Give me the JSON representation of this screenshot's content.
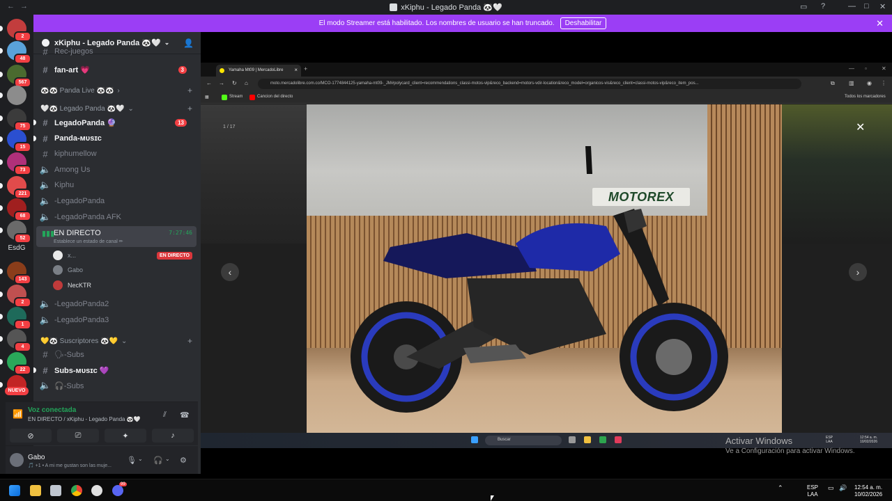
{
  "window": {
    "title": "xKiphu - Legado Panda 🐼🤍"
  },
  "streamer_banner": {
    "text": "El modo Streamer está habilitado. Los nombres de usuario se han truncado.",
    "button": "Deshabilitar"
  },
  "guilds": [
    {
      "badge": "2",
      "color": "#c23d3d"
    },
    {
      "badge": "48",
      "color": "#5aa2d9"
    },
    {
      "badge": "567",
      "color": "#4a6a2f"
    },
    {
      "badge": "",
      "color": "#8c8c8c"
    },
    {
      "badge": "75",
      "color": "#3b3b3b"
    },
    {
      "badge": "15",
      "color": "#2b4fd0"
    },
    {
      "badge": "73",
      "color": "#b0307a"
    },
    {
      "badge": "221",
      "color": "#e14b4b"
    },
    {
      "badge": "68",
      "color": "#a01f1f"
    },
    {
      "badge": "52",
      "color": "#6a6a6a"
    },
    {
      "badge": "143",
      "color": "#8a3d1a"
    },
    {
      "badge": "2",
      "color": "#c05050"
    },
    {
      "badge": "1",
      "color": "#1e6a5a"
    },
    {
      "badge": "4",
      "color": "#555555"
    },
    {
      "badge": "22",
      "color": "#2aa85a"
    },
    {
      "badge": "",
      "color": "#c22424"
    }
  ],
  "guild_text": {
    "esdg": "EsdG",
    "nuevo": "NUEVO"
  },
  "server": {
    "name": "xKiphu - Legado Panda 🐼🤍",
    "channels": {
      "top_cut": "Rec-juegos",
      "fanart": "fan-art 💗",
      "fanart_badge": "3",
      "cat_panda_live": "🐼🐼 Panda Live 🐼🐼",
      "cat_legado": "🤍🐼 Legado Panda 🐼🤍",
      "legado_panda": "LegadoPanda 🔮",
      "legado_panda_badge": "13",
      "panda_music": "Panda-ᴍᴜsɪᴄ",
      "kiphumellow": "kiphumellow",
      "among_us": "Among Us",
      "kiphu": "Kiphu",
      "legadopanda_v": "-LegadoPanda",
      "legadopanda_afk": "-LegadoPanda AFK",
      "live_name": "EN DIRECTO",
      "live_time": "7:27:46",
      "live_sub": "Establece un estado de canal ✏",
      "legadopanda2": "-LegadoPanda2",
      "legadopanda3": "-LegadoPanda3",
      "cat_subs": "💛🐼 Suscriptores 🐼💛",
      "subs_text": "🗣-Subs",
      "subs_music": "Subs-ᴍᴜsɪᴄ 💜",
      "subs_voice": "🎧-Subs"
    },
    "voice_users": [
      {
        "name": "x...",
        "live": "EN DIRECTO",
        "color": "#e9e9e9"
      },
      {
        "name": "Gabo",
        "live": "",
        "color": "#7a7f86"
      },
      {
        "name": "NecKTR",
        "live": "",
        "color": "#c03b3b"
      }
    ]
  },
  "voice_panel": {
    "status": "Voz conectada",
    "channel": "EN DIRECTO / xKiphu - Legado Panda 🐼🤍"
  },
  "user_panel": {
    "name": "Gabo",
    "status": "🎵 +1 • A mi me gustan son las muje..."
  },
  "stream": {
    "tab_title": "Yamaha Mt09 | MercadoLibre",
    "url": "moto.mercadolibre.com.co/MCO-1774844125-yamaha-mt09-_JM#polycard_client=recommendations_classi-motos-vip&reco_backend=motors-vdir-location&reco_model=organicos-vis&reco_client=classi-motos-vip&reco_item_pos...",
    "bookmarks": [
      "Stream",
      "Cancion del directo"
    ],
    "all_bookmarks": "Todos los marcadores",
    "counter": "1 / 17",
    "logo": "MOTOREX",
    "search": "Buscar",
    "lang": "ESP\nLAA",
    "time": "12:54 a. m.\n10/02/2026"
  },
  "activate_windows": {
    "title": "Activar Windows",
    "subtitle": "Ve a Configuración para activar Windows."
  },
  "taskbar": {
    "lang_top": "ESP",
    "lang_bottom": "LAA",
    "time": "12:54 a. m.",
    "date": "10/02/2026",
    "discord_badge": "99"
  }
}
